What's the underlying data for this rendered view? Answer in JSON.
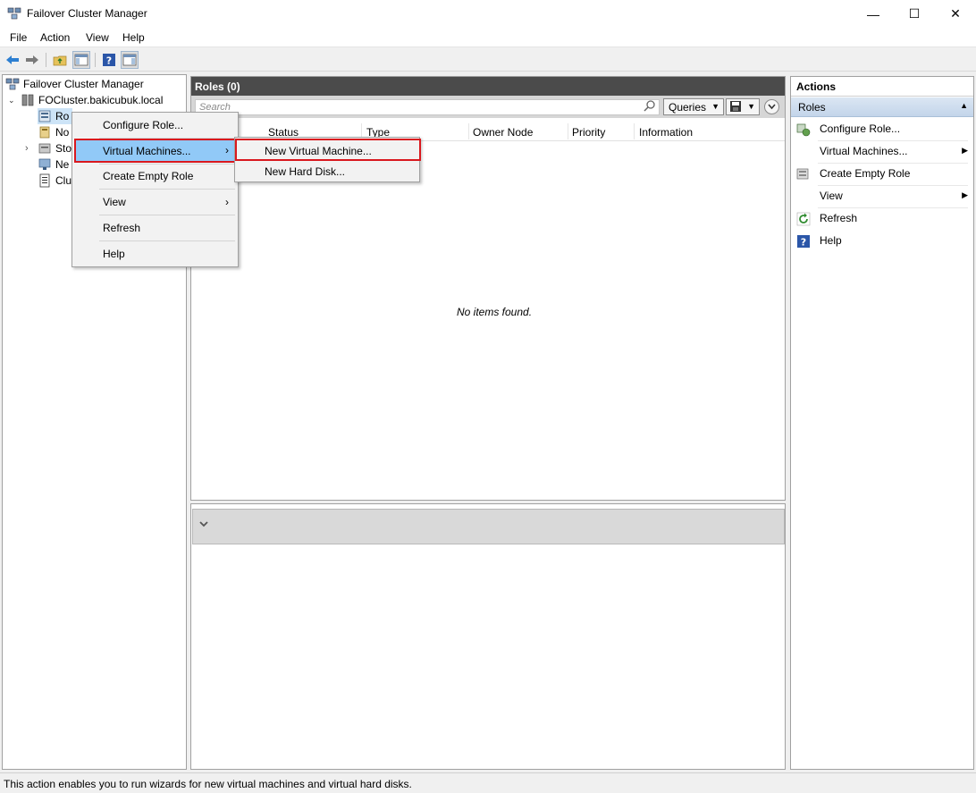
{
  "window": {
    "title": "Failover Cluster Manager",
    "minimize_glyph": "—",
    "maximize_glyph": "☐",
    "close_glyph": "✕"
  },
  "menu": [
    "File",
    "Action",
    "View",
    "Help"
  ],
  "tree": {
    "root": "Failover Cluster Manager",
    "cluster": "FOCluster.bakicubuk.local",
    "children": [
      "Ro",
      "No",
      "Sto",
      "Ne",
      "Clu"
    ]
  },
  "center": {
    "title": "Roles (0)",
    "search_placeholder": "Search",
    "queries_label": "Queries",
    "columns": [
      "Status",
      "Type",
      "Owner Node",
      "Priority",
      "Information"
    ],
    "empty_message": "No items found."
  },
  "actions": {
    "title": "Actions",
    "section": "Roles",
    "items": [
      "Configure Role...",
      "Virtual Machines...",
      "Create Empty Role",
      "View",
      "Refresh",
      "Help"
    ]
  },
  "context_menu": {
    "items": [
      "Configure Role...",
      "Virtual Machines...",
      "Create Empty Role",
      "View",
      "Refresh",
      "Help"
    ]
  },
  "submenu": {
    "items": [
      "New Virtual Machine...",
      "New Hard Disk..."
    ]
  },
  "status": "This action enables you to run wizards for new virtual machines and virtual hard disks.",
  "colors": {
    "highlight": "#91c9f7",
    "outline_red": "#d9181e",
    "pane_header": "#4b4b4b"
  }
}
